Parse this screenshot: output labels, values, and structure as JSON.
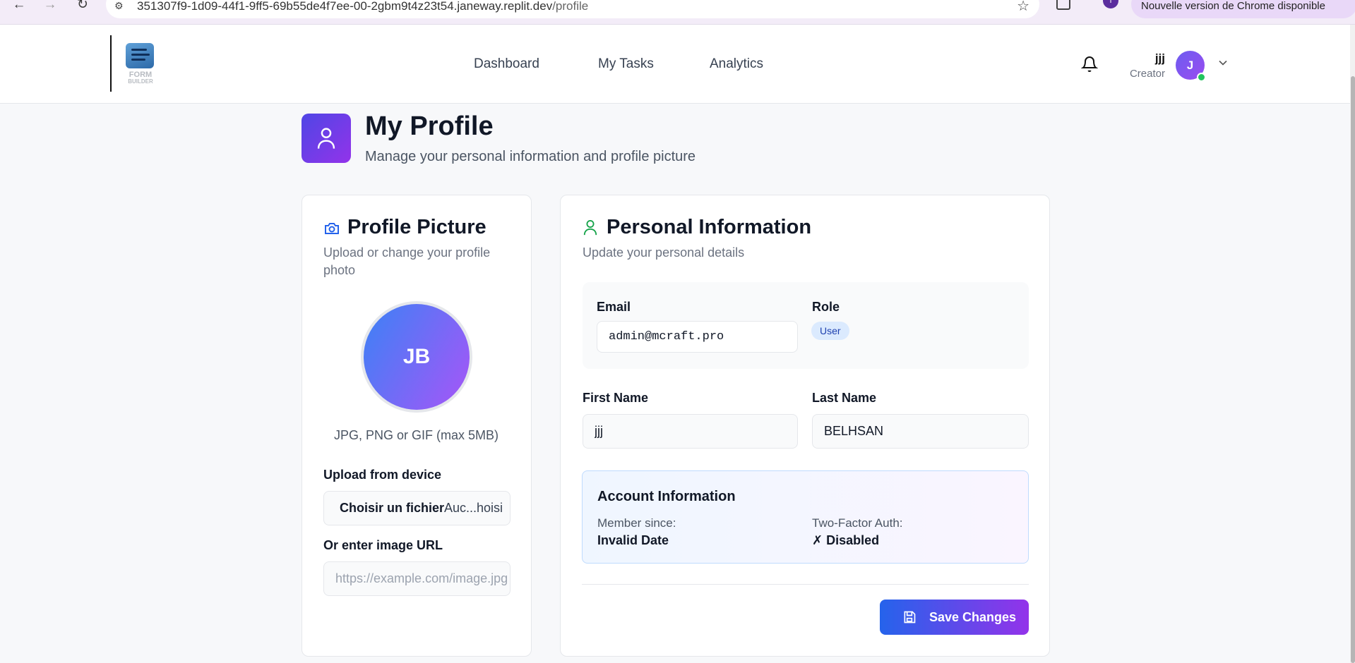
{
  "browser": {
    "url_host": "351307f9-1d09-44f1-9ff5-69b55de4f7ee-00-2gbm9t4z23t54.janeway.replit.dev",
    "url_path": "/profile",
    "update_notice": "Nouvelle version de Chrome disponible",
    "profile_initial": "I"
  },
  "header": {
    "logo_text": "FORM",
    "logo_subtext": "BUILDER",
    "nav": [
      "Dashboard",
      "My Tasks",
      "Analytics"
    ],
    "user": {
      "name": "jjj",
      "role": "Creator",
      "initial": "J",
      "status_color": "#22c55e"
    }
  },
  "page": {
    "title": "My Profile",
    "subtitle": "Manage your personal information and profile picture"
  },
  "profile_picture": {
    "title": "Profile Picture",
    "subtitle": "Upload or change your profile photo",
    "initials": "JB",
    "hint": "JPG, PNG or GIF (max 5MB)",
    "upload_label": "Upload from device",
    "file_button": "Choisir un fichier",
    "file_status": "Auc...hoisi",
    "url_label": "Or enter image URL",
    "url_placeholder": "https://example.com/image.jpg"
  },
  "personal_info": {
    "title": "Personal Information",
    "subtitle": "Update your personal details",
    "email_label": "Email",
    "email_value": "admin@mcraft.pro",
    "role_label": "Role",
    "role_value": "User",
    "first_name_label": "First Name",
    "first_name_value": "jjj",
    "last_name_label": "Last Name",
    "last_name_value": "BELHSAN",
    "account": {
      "title": "Account Information",
      "member_since_label": "Member since:",
      "member_since_value": "Invalid Date",
      "two_factor_label": "Two-Factor Auth:",
      "two_factor_value": "✗ Disabled"
    },
    "save_label": "Save Changes"
  },
  "colors": {
    "accent_start": "#2563eb",
    "accent_end": "#9333ea",
    "avatar_start": "#3b82f6",
    "avatar_end": "#a855f7",
    "role_badge_bg": "#dbeafe"
  },
  "icons": [
    "back-icon",
    "forward-icon",
    "reload-icon",
    "site-settings-icon",
    "star-icon",
    "extensions-icon",
    "bell-icon",
    "chevron-down-icon",
    "user-icon",
    "camera-icon",
    "save-icon"
  ]
}
